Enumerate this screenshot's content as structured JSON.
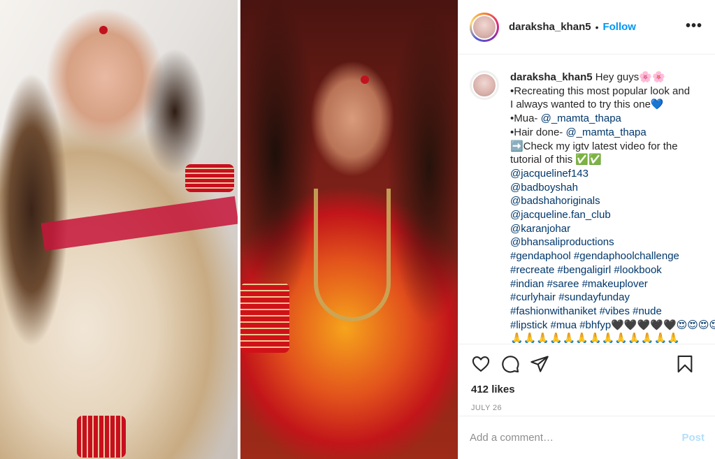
{
  "header": {
    "username": "daraksha_khan5",
    "separator": "•",
    "follow_label": "Follow",
    "more_label": "•••"
  },
  "caption": {
    "username": "daraksha_khan5",
    "lines": [
      "Hey guys🌸🌸",
      "•Recreating this most popular look and",
      "I always wanted to try this one💙",
      "•Mua- ",
      "@_mamta_thapa",
      "•Hair done- ",
      "@_mamta_thapa",
      "➡️Check my igtv latest video for the",
      "tutorial of this ✅✅"
    ],
    "mentions": [
      "@jacquelinef143",
      "@badboyshah",
      "@badshahoriginals",
      "@jacqueline.fan_club",
      "@karanjohar",
      "@bhansaliproductions"
    ],
    "hashtag_lines": [
      "#gendaphool #gendaphoolchallenge",
      "#recreate #bengaligirl #lookbook",
      "#indian #saree #makeuplover",
      "#curlyhair #sundayfunday",
      "#fashionwithaniket #vibes #nude",
      "#lipstick #mua #bhfyp🖤🖤🖤🖤🖤😍😍😍😍",
      "🙏🙏🙏🙏🙏🙏🙏🙏🙏🙏🙏🙏🙏"
    ]
  },
  "actions": {
    "likes": "412 likes",
    "date": "JULY 26"
  },
  "comment": {
    "placeholder": "Add a comment…",
    "post_label": "Post"
  },
  "icons": [
    "heart-icon",
    "comment-icon",
    "share-icon",
    "bookmark-icon",
    "more-icon"
  ],
  "colors": {
    "link": "#00376b",
    "follow": "#0095f6",
    "post_disabled": "#b2dffc",
    "muted": "#8e8e8e"
  }
}
